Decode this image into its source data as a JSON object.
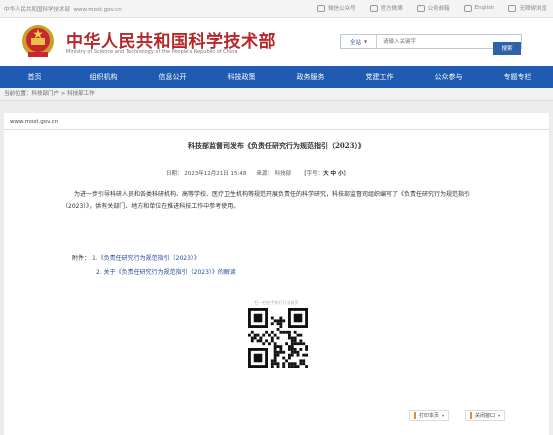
{
  "topbar": {
    "site_name": "中华人民共和国科学技术部",
    "url": "www.most.gov.cn",
    "links": [
      "微信公众号",
      "官方微博",
      "公务邮箱",
      "English",
      "无障碍浏览"
    ]
  },
  "header": {
    "title_cn": "中华人民共和国科学技术部",
    "title_en": "Ministry of Science and Technology of the People's Republic of China",
    "search_scope": "全站",
    "search_placeholder": "请输入关键字",
    "search_button": "搜索"
  },
  "nav": {
    "items": [
      "首页",
      "组织机构",
      "信息公开",
      "科技政策",
      "政务服务",
      "党建工作",
      "公众参与",
      "专题专栏"
    ]
  },
  "breadcrumb": {
    "label": "当前位置：",
    "path": "科技部门户 > 科技部工作"
  },
  "article": {
    "domain": "www.most.gov.cn",
    "title": "科技部监督司发布《负责任研究行为规范指引（2023）》",
    "date": "日期：  2023年12月21日  15:48",
    "source": "来源：  科技部",
    "font_size_label": "【字号：",
    "font_sizes": "大 中 小",
    "font_size_close": "】",
    "body": "为进一步引导科研人员和各类科研机构、高等学校、医疗卫生机构等规范开展负责任的科学研究，科技部监督司组织编写了《负责任研究行为规范指引（2023）》，供有关部门、地方和单位在推进科技工作中参考使用。",
    "attachment_label": "附件：",
    "attachment_1": "1.《负责任研究行为规范指引（2023）》",
    "attachment_2": "2. 关于《负责任研究行为规范指引（2023）》的解读",
    "qr_label": "扫一扫在手机打开当前页",
    "print_label": "打印本页",
    "close_label": "关闭窗口"
  },
  "colors": {
    "brand_red": "#b4272b",
    "nav_blue": "#1f5bb1",
    "link_blue": "#1f4d96",
    "accent_orange": "#e0902a"
  }
}
